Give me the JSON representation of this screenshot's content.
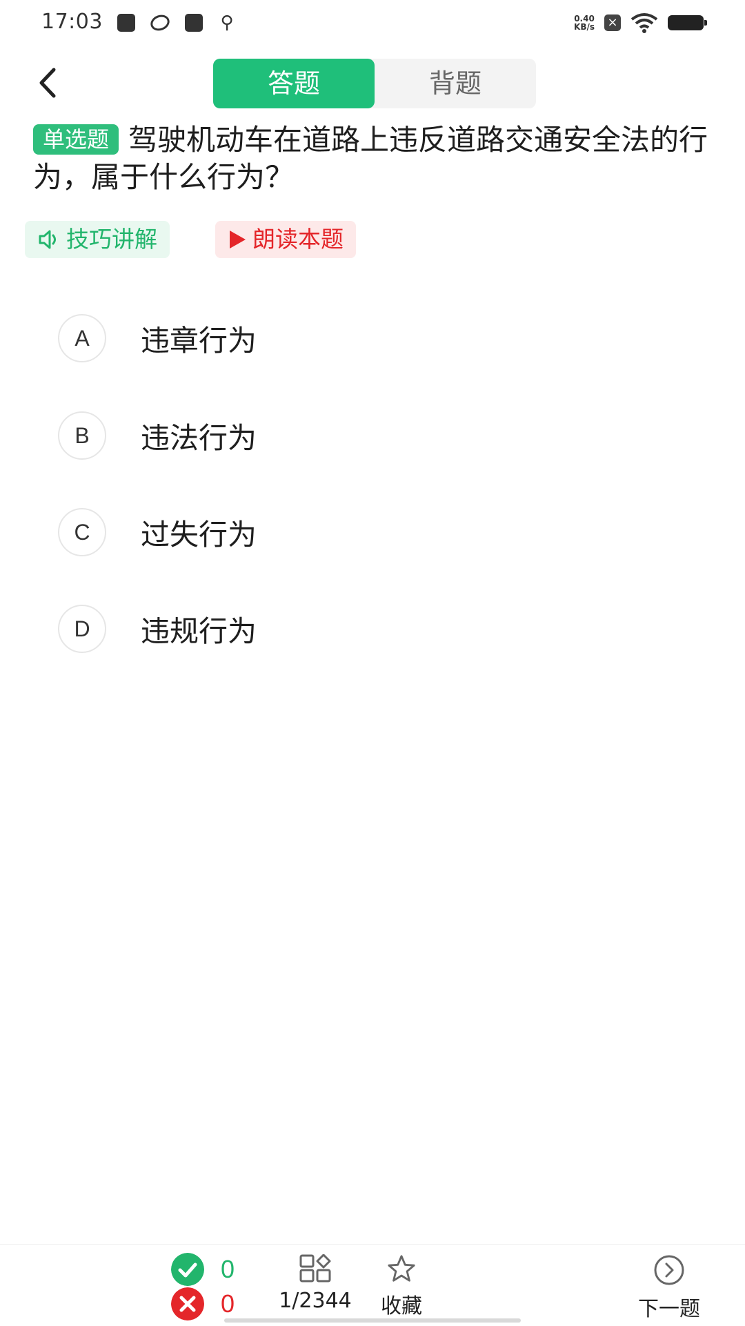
{
  "status_bar": {
    "time": "17:03",
    "net_speed_value": "0.40",
    "net_speed_unit": "KB/s",
    "icons": [
      "clipboard-check-icon",
      "swirl-icon",
      "mail-icon",
      "usb-icon",
      "sim-x-icon",
      "wifi-icon",
      "battery-icon"
    ]
  },
  "header": {
    "tabs": [
      {
        "label": "答题",
        "active": true
      },
      {
        "label": "背题",
        "active": false
      }
    ]
  },
  "question": {
    "type_label": "单选题",
    "text": "驾驶机动车在道路上违反道路交通安全法的行为，属于什么行为？"
  },
  "actions": {
    "tip_label": "技巧讲解",
    "read_label": "朗读本题"
  },
  "options": [
    {
      "letter": "A",
      "text": "违章行为"
    },
    {
      "letter": "B",
      "text": "违法行为"
    },
    {
      "letter": "C",
      "text": "过失行为"
    },
    {
      "letter": "D",
      "text": "违规行为"
    }
  ],
  "bottom_bar": {
    "correct_count": "0",
    "wrong_count": "0",
    "progress": "1/2344",
    "favorite_label": "收藏",
    "next_label": "下一题"
  },
  "colors": {
    "accent_green": "#1fbf7a",
    "tag_green": "#2fbe7c",
    "red": "#e4262a"
  }
}
